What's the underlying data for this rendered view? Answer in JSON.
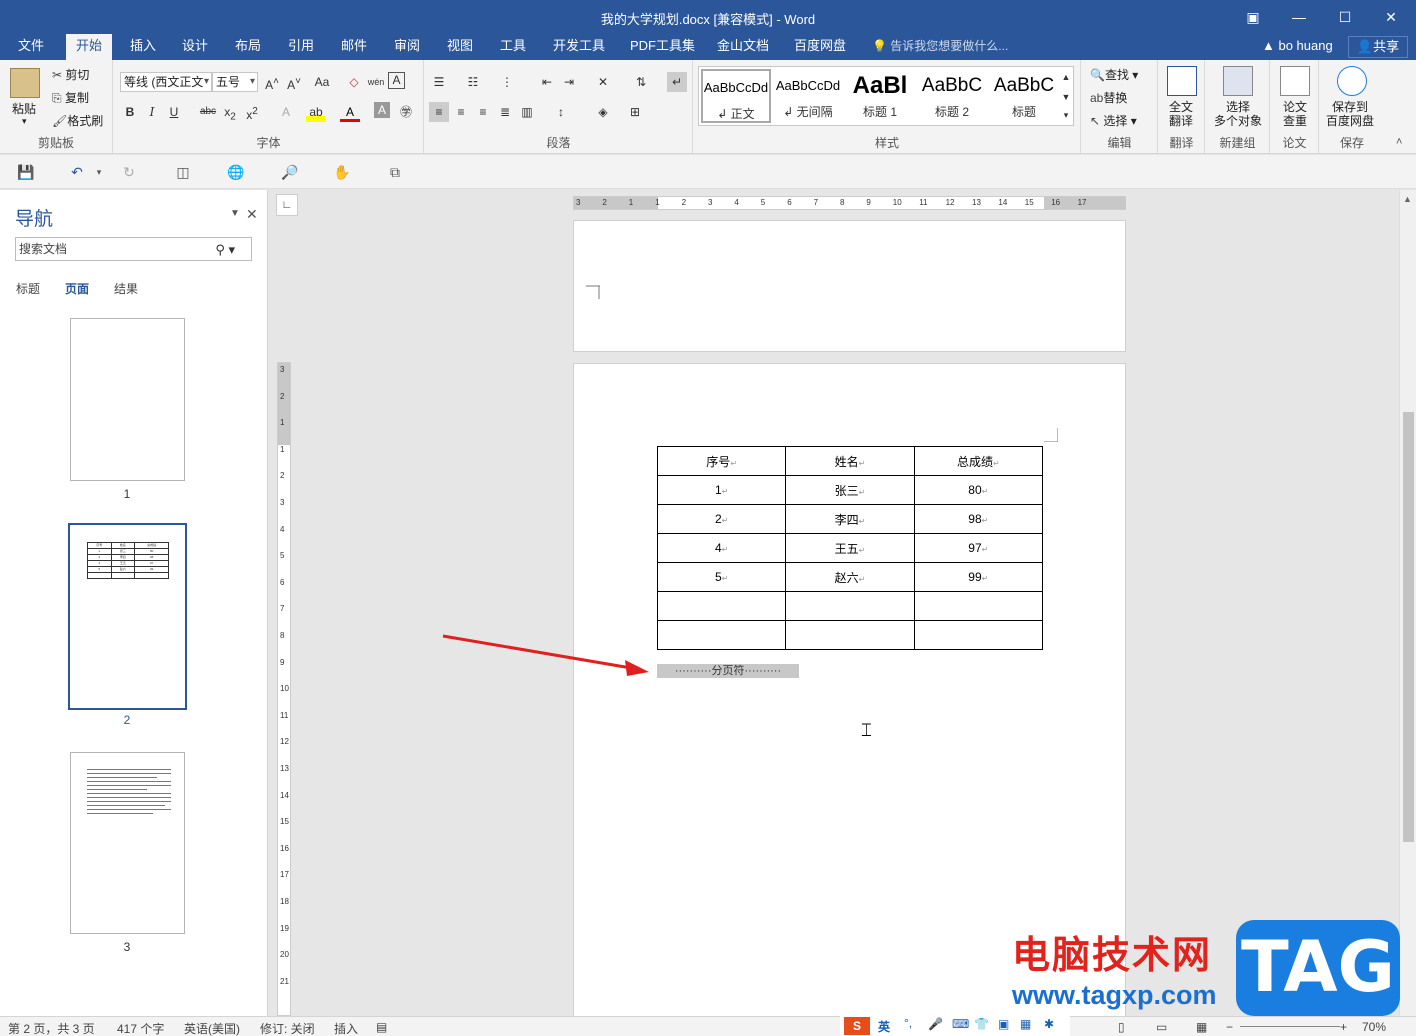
{
  "window": {
    "title": "我的大学规划.docx [兼容模式] - Word",
    "controls": [
      "▣",
      "—",
      "☐",
      "✕"
    ]
  },
  "menu": {
    "tabs": [
      "文件",
      "开始",
      "插入",
      "设计",
      "布局",
      "引用",
      "邮件",
      "审阅",
      "视图",
      "工具",
      "开发工具",
      "PDF工具集",
      "金山文档",
      "百度网盘"
    ],
    "active": "开始",
    "tell_me": "告诉我您想要做什么...",
    "user": "bo huang",
    "share": "共享"
  },
  "ribbon": {
    "clipboard": {
      "label": "剪贴板",
      "paste": "粘贴",
      "cut": "剪切",
      "copy": "复制",
      "format_painter": "格式刷"
    },
    "font": {
      "label": "字体",
      "font_name": "等线 (西文正文",
      "font_size": "五号"
    },
    "paragraph": {
      "label": "段落"
    },
    "styles": {
      "label": "样式",
      "items": [
        {
          "sample": "AaBbCcDd",
          "name": "↲ 正文"
        },
        {
          "sample": "AaBbCcDd",
          "name": "↲ 无间隔"
        },
        {
          "sample": "AaBl",
          "name": "标题 1"
        },
        {
          "sample": "AaBbC",
          "name": "标题 2"
        },
        {
          "sample": "AaBbC",
          "name": "标题"
        }
      ]
    },
    "editing": {
      "label": "编辑",
      "find": "查找",
      "replace": "替换",
      "select": "选择"
    },
    "translate": {
      "label": "翻译",
      "button": "全文\n翻译"
    },
    "newgroup": {
      "label": "新建组",
      "button": "选择\n多个对象"
    },
    "paper": {
      "label": "论文",
      "button": "论文\n查重"
    },
    "save": {
      "label": "保存",
      "button": "保存到\n百度网盘"
    }
  },
  "nav": {
    "title": "导航",
    "search_placeholder": "搜索文档",
    "tabs": [
      "标题",
      "页面",
      "结果"
    ],
    "active_tab": "页面",
    "pages": [
      "1",
      "2",
      "3"
    ],
    "selected_page": "2"
  },
  "document": {
    "table": {
      "headers": [
        "序号",
        "姓名",
        "总成绩"
      ],
      "rows": [
        [
          "1",
          "张三",
          "80"
        ],
        [
          "2",
          "李四",
          "98"
        ],
        [
          "4",
          "王五",
          "97"
        ],
        [
          "5",
          "赵六",
          "99"
        ],
        [
          "",
          "",
          ""
        ],
        [
          "",
          "",
          ""
        ]
      ]
    },
    "page_break": "分页符",
    "ruler_h": [
      "3",
      "2",
      "1",
      "1",
      "2",
      "3",
      "4",
      "5",
      "6",
      "7",
      "8",
      "9",
      "10",
      "11",
      "12",
      "13",
      "14",
      "15",
      "16",
      "17"
    ],
    "ruler_v": [
      "3",
      "2",
      "1",
      "1",
      "2",
      "3",
      "4",
      "5",
      "6",
      "7",
      "8",
      "9",
      "10",
      "11",
      "12",
      "13",
      "14",
      "15",
      "16",
      "17",
      "18",
      "19",
      "20",
      "21"
    ]
  },
  "status": {
    "page": "第 2 页，共 3 页",
    "words": "417 个字",
    "language": "英语(美国)",
    "track": "修订: 关闭",
    "mode": "插入",
    "zoom": "70%"
  },
  "watermark": {
    "text": "电脑技术网",
    "url": "www.tagxp.com",
    "logo": "TAG"
  },
  "ime": {
    "lang": "英"
  }
}
